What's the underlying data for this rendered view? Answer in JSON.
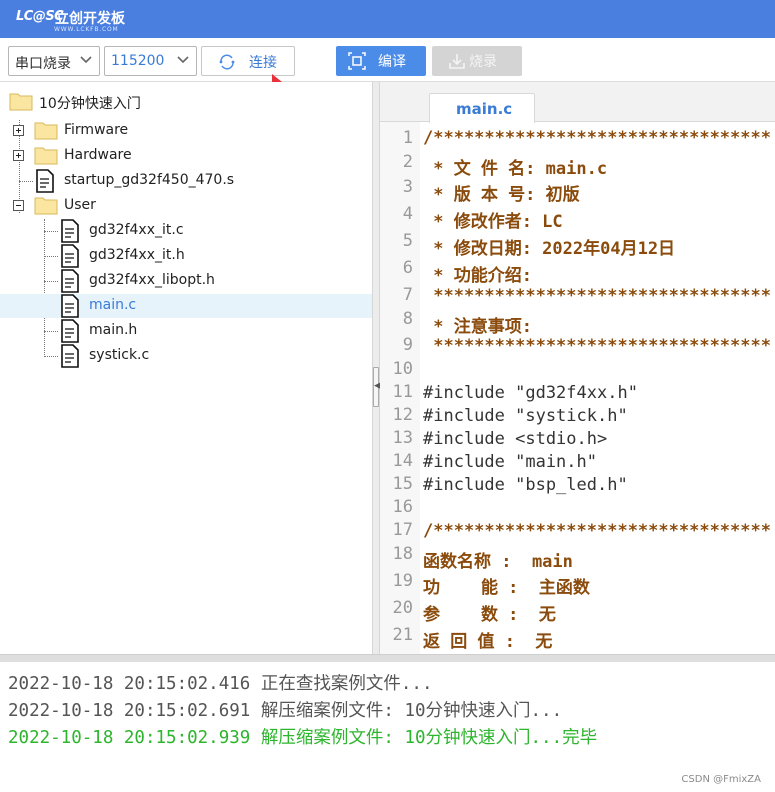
{
  "app": {
    "logo_mark": "LC@SC",
    "title": "立创开发板",
    "url": "WWW.LCKFB.COM"
  },
  "toolbar": {
    "mode_select": "串口烧录",
    "baud_select": "115200",
    "connect_label": "连接",
    "compile_label": "编译",
    "burn_label": "烧录"
  },
  "tree": {
    "root": "10分钟快速入门",
    "items": [
      {
        "label": "Firmware",
        "type": "folder"
      },
      {
        "label": "Hardware",
        "type": "folder"
      },
      {
        "label": "startup_gd32f450_470.s",
        "type": "file"
      },
      {
        "label": "User",
        "type": "folder"
      },
      {
        "label": "gd32f4xx_it.c",
        "type": "file"
      },
      {
        "label": "gd32f4xx_it.h",
        "type": "file"
      },
      {
        "label": "gd32f4xx_libopt.h",
        "type": "file"
      },
      {
        "label": "main.c",
        "type": "file",
        "selected": true
      },
      {
        "label": "main.h",
        "type": "file"
      },
      {
        "label": "systick.c",
        "type": "file"
      }
    ]
  },
  "editor": {
    "tab": "main.c",
    "line_numbers": [
      "1",
      "2",
      "3",
      "4",
      "5",
      "6",
      "7",
      "8",
      "9",
      "10",
      "11",
      "12",
      "13",
      "14",
      "15",
      "16",
      "17",
      "18",
      "19",
      "20",
      "21"
    ],
    "lines": [
      "/*********************************",
      " * 文 件 名: main.c",
      " * 版 本 号: 初版",
      " * 修改作者: LC",
      " * 修改日期: 2022年04月12日",
      " * 功能介绍:",
      " *********************************",
      " * 注意事项:",
      " *********************************",
      "",
      "#include \"gd32f4xx.h\"",
      "#include \"systick.h\"",
      "#include <stdio.h>",
      "#include \"main.h\"",
      "#include \"bsp_led.h\"",
      "",
      "/*********************************",
      "函数名称 :  main",
      "功    能 :  主函数",
      "参    数 :  无",
      "返 回 值 :  无"
    ]
  },
  "log": {
    "lines": [
      {
        "time": "2022-10-18 20:15:02.416",
        "text": "正在查找案例文件..."
      },
      {
        "time": "2022-10-18 20:15:02.691",
        "text": "解压缩案例文件: 10分钟快速入门..."
      },
      {
        "time": "2022-10-18 20:15:02.939",
        "text": "解压缩案例文件: 10分钟快速入门...完毕"
      }
    ]
  },
  "watermark": "CSDN @FmixZA",
  "colors": {
    "titlebar": "#4a7fe0",
    "accent": "#3a7bd5",
    "comment": "#8a4b0c",
    "log_success": "#2db52d",
    "log_normal": "#555555",
    "annotation_arrow": "#e8313a"
  }
}
